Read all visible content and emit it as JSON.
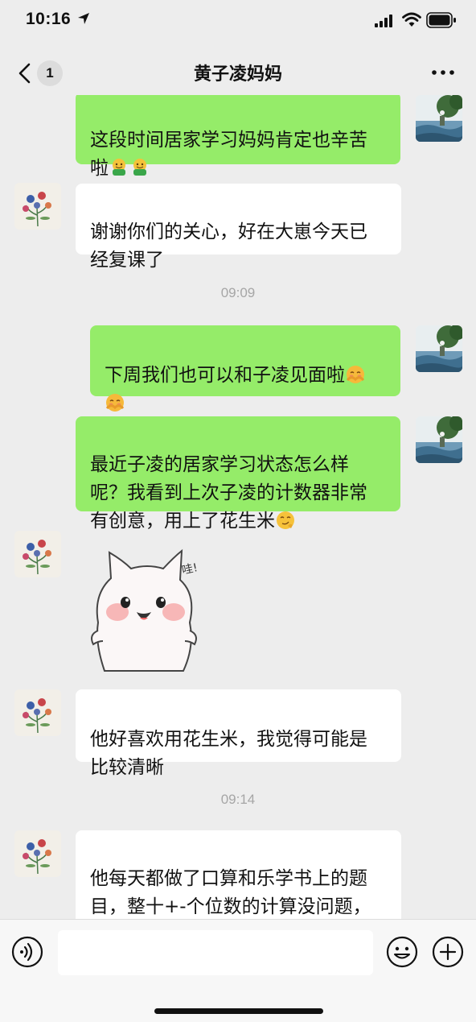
{
  "status_bar": {
    "time": "10:16"
  },
  "nav": {
    "badge": "1",
    "title": "黄子凌妈妈"
  },
  "messages": [
    {
      "text": "这段时间居家学习妈妈肯定也辛苦\n啦"
    },
    {
      "text": "谢谢你们的关心，好在大崽今天已\n经复课了"
    },
    {
      "text": "09:09"
    },
    {
      "text": "下周我们也可以和子凌见面啦"
    },
    {
      "text": "最近子凌的居家学习状态怎么样\n呢？我看到上次子凌的计数器非常\n有创意，用上了花生米"
    },
    {
      "sticker_text": "哇!"
    },
    {
      "text": "他好喜欢用花生米，我觉得可能是\n比较清晰"
    },
    {
      "text": "09:14"
    },
    {
      "text": "他每天都做了口算和乐学书上的题\n目，整十+-个位数的计算没问题，\n能够理解"
    }
  ],
  "icons": {
    "voice": "voice-icon",
    "emoji": "emoji-icon",
    "plus": "plus-icon"
  },
  "colors": {
    "self_bubble": "#95ec69",
    "other_bubble": "#ffffff",
    "background": "#ededed"
  }
}
